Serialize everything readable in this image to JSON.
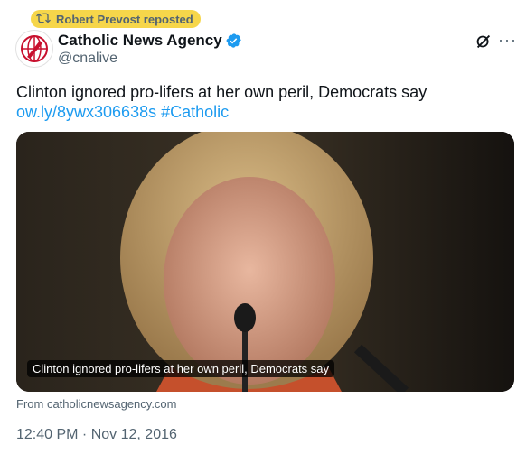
{
  "repost": {
    "text": "Robert Prevost reposted",
    "icon": "repost-icon",
    "highlight_color": "#f6d64a"
  },
  "author": {
    "display_name": "Catholic News Agency",
    "handle": "@cnalive",
    "verified": true,
    "verified_color": "#1d9bf0",
    "avatar_icon": "cna-logo-icon"
  },
  "actions": {
    "grok_icon": "grok-icon",
    "more_label": "···"
  },
  "tweet": {
    "text": "Clinton ignored pro-lifers at her own peril, Democrats say",
    "link": "ow.ly/8ywx306638s",
    "hashtag": "#Catholic",
    "link_color": "#1d9bf0"
  },
  "card": {
    "caption": "Clinton ignored pro-lifers at her own peril, Democrats say",
    "source": "From catholicnewsagency.com"
  },
  "timestamp": "12:40 PM · Nov 12, 2016"
}
